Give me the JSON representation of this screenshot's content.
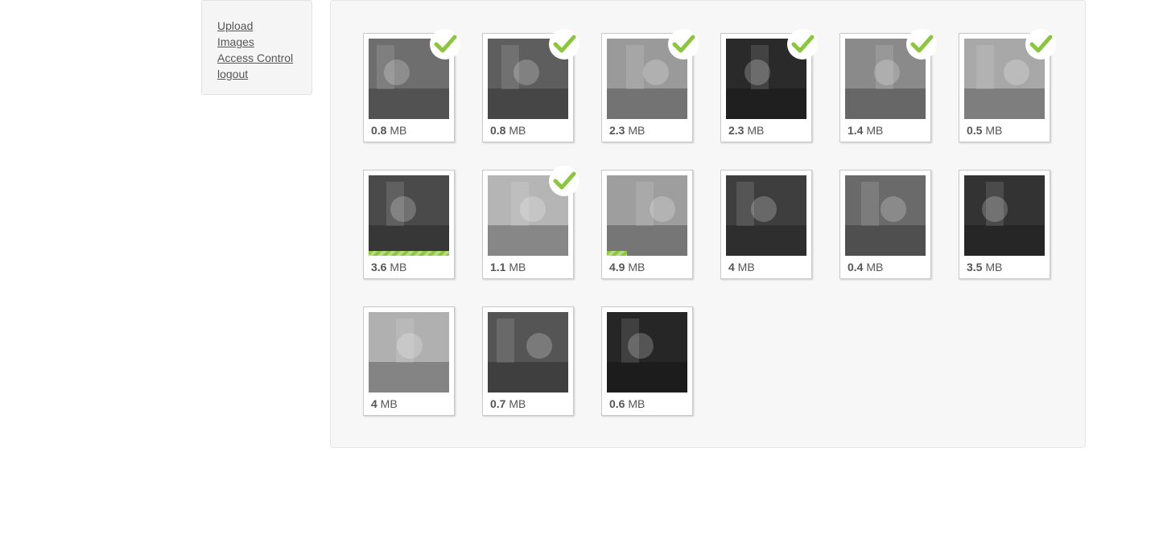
{
  "nav": {
    "items": [
      {
        "label": "Upload"
      },
      {
        "label": "Images"
      },
      {
        "label": "Access Control"
      },
      {
        "label": "logout"
      }
    ]
  },
  "gallery": {
    "accent_color": "#8cc63f",
    "images": [
      {
        "size_num": "0.8",
        "unit": "MB",
        "done": true,
        "progress": null,
        "tone": "#6e6e6e"
      },
      {
        "size_num": "0.8",
        "unit": "MB",
        "done": true,
        "progress": null,
        "tone": "#5e5e5e"
      },
      {
        "size_num": "2.3",
        "unit": "MB",
        "done": true,
        "progress": null,
        "tone": "#9a9a9a"
      },
      {
        "size_num": "2.3",
        "unit": "MB",
        "done": true,
        "progress": null,
        "tone": "#2a2a2a"
      },
      {
        "size_num": "1.4",
        "unit": "MB",
        "done": true,
        "progress": null,
        "tone": "#8a8a8a"
      },
      {
        "size_num": "0.5",
        "unit": "MB",
        "done": true,
        "progress": null,
        "tone": "#a8a8a8"
      },
      {
        "size_num": "3.6",
        "unit": "MB",
        "done": false,
        "progress": 1.0,
        "tone": "#4a4a4a"
      },
      {
        "size_num": "1.1",
        "unit": "MB",
        "done": true,
        "progress": null,
        "tone": "#b5b5b5"
      },
      {
        "size_num": "4.9",
        "unit": "MB",
        "done": false,
        "progress": 0.25,
        "tone": "#9e9e9e"
      },
      {
        "size_num": "4",
        "unit": "MB",
        "done": false,
        "progress": null,
        "tone": "#3e3e3e"
      },
      {
        "size_num": "0.4",
        "unit": "MB",
        "done": false,
        "progress": null,
        "tone": "#6a6a6a"
      },
      {
        "size_num": "3.5",
        "unit": "MB",
        "done": false,
        "progress": null,
        "tone": "#333333"
      },
      {
        "size_num": "4",
        "unit": "MB",
        "done": false,
        "progress": null,
        "tone": "#b0b0b0"
      },
      {
        "size_num": "0.7",
        "unit": "MB",
        "done": false,
        "progress": null,
        "tone": "#555555"
      },
      {
        "size_num": "0.6",
        "unit": "MB",
        "done": false,
        "progress": null,
        "tone": "#262626"
      }
    ]
  }
}
